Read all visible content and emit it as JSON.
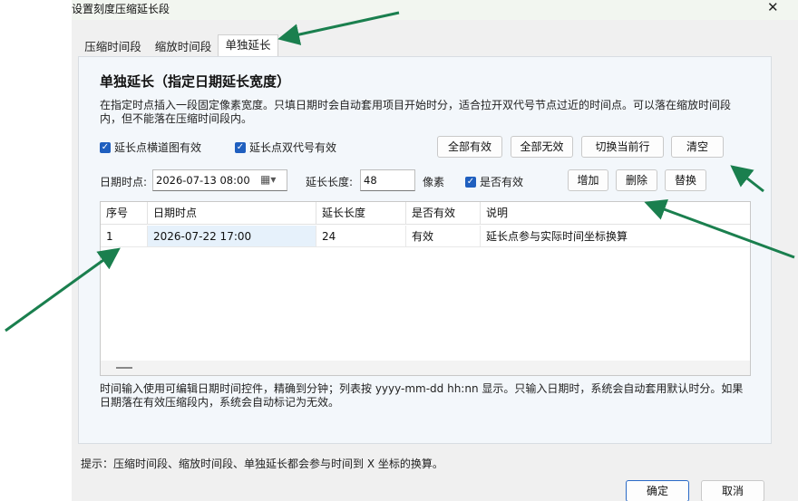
{
  "window": {
    "title": "设置刻度压缩延长段",
    "close_glyph": "✕"
  },
  "tabs": [
    {
      "label": "压缩时间段",
      "active": false
    },
    {
      "label": "缩放时间段",
      "active": false
    },
    {
      "label": "单独延长",
      "active": true
    }
  ],
  "section": {
    "heading": "单独延长（指定日期延长宽度）",
    "description": "在指定时点插入一段固定像素宽度。只填日期时会自动套用项目开始时分，适合拉开双代号节点过近的时间点。可以落在缩放时间段内，但不能落在压缩时间段内。"
  },
  "options": {
    "cross_section_valid": {
      "label": "延长点横道图有效",
      "checked": true
    },
    "double_code_valid": {
      "label": "延长点双代号有效",
      "checked": true
    }
  },
  "bulk_buttons": {
    "all_valid": "全部有效",
    "all_invalid": "全部无效",
    "toggle_current": "切换当前行",
    "clear": "清空"
  },
  "form": {
    "date_label": "日期时点:",
    "date_value": "2026-07-13 08:00",
    "calendar_icon": "calendar-icon",
    "length_label": "延长长度:",
    "length_value": "48",
    "unit": "像素",
    "valid_label": "是否有效",
    "valid_checked": true
  },
  "row_buttons": {
    "add": "增加",
    "delete": "删除",
    "replace": "替换"
  },
  "table": {
    "columns": [
      "序号",
      "日期时点",
      "延长长度",
      "是否有效",
      "说明"
    ],
    "rows": [
      {
        "index": "1",
        "date": "2026-07-22 17:00",
        "length": "24",
        "valid": "有效",
        "note": "延长点参与实际时间坐标换算"
      }
    ]
  },
  "footnote": "时间输入使用可编辑日期时间控件，精确到分钟；列表按 yyyy-mm-dd hh:nn 显示。只输入日期时，系统会自动套用默认时分。如果日期落在有效压缩段内，系统会自动标记为无效。",
  "tip": "提示：压缩时间段、缩放时间段、单独延长都会参与时间到 X 坐标的换算。",
  "dialog_buttons": {
    "ok": "确定",
    "cancel": "取消"
  },
  "colors": {
    "accent": "#1f5fbf",
    "annotation_arrow": "#1a7f4e",
    "panel_bg": "#f3f7fb",
    "selected_cell": "#e6f1fb"
  }
}
